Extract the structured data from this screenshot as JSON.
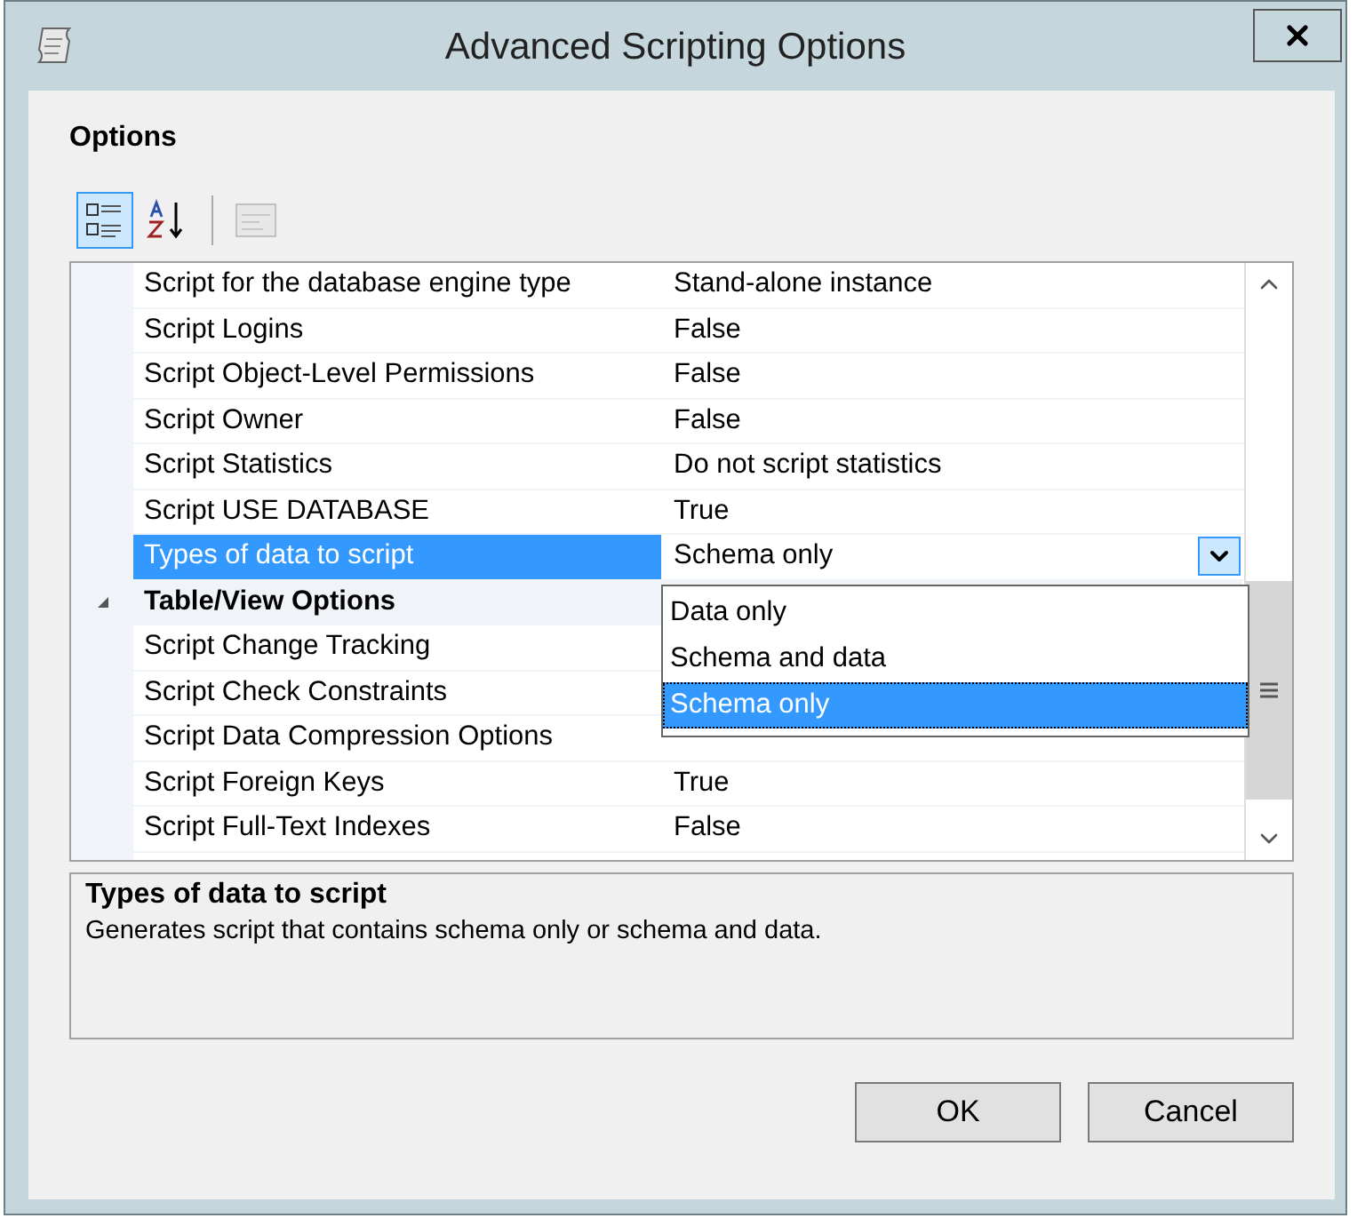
{
  "window": {
    "title": "Advanced Scripting Options"
  },
  "options_label": "Options",
  "toolbar": [
    {
      "kind": "categorized",
      "selected": true,
      "disabled": false
    },
    {
      "kind": "alphabetical",
      "selected": false,
      "disabled": false
    },
    {
      "kind": "property_pages",
      "selected": false,
      "disabled": true
    }
  ],
  "grid": {
    "rows": [
      {
        "kind": "property",
        "name": "Script for the database engine type",
        "value": "Stand-alone instance",
        "selected": false
      },
      {
        "kind": "property",
        "name": "Script Logins",
        "value": "False",
        "selected": false
      },
      {
        "kind": "property",
        "name": "Script Object-Level Permissions",
        "value": "False",
        "selected": false
      },
      {
        "kind": "property",
        "name": "Script Owner",
        "value": "False",
        "selected": false
      },
      {
        "kind": "property",
        "name": "Script Statistics",
        "value": "Do not script statistics",
        "selected": false
      },
      {
        "kind": "property",
        "name": "Script USE DATABASE",
        "value": "True",
        "selected": false
      },
      {
        "kind": "property",
        "name": "Types of data to script",
        "value": "Schema only",
        "selected": true
      },
      {
        "kind": "category",
        "name": "Table/View Options",
        "expanded": true,
        "selected": false
      },
      {
        "kind": "property",
        "name": "Script Change Tracking",
        "selected": false
      },
      {
        "kind": "property",
        "name": "Script Check Constraints",
        "selected": false
      },
      {
        "kind": "property",
        "name": "Script Data Compression Options",
        "selected": false
      },
      {
        "kind": "property",
        "name": "Script Foreign Keys",
        "value": "True",
        "selected": false
      },
      {
        "kind": "property",
        "name": "Script Full-Text Indexes",
        "value": "False",
        "selected": false
      }
    ],
    "dropdown": {
      "items": [
        {
          "label": "Data only",
          "selected": false
        },
        {
          "label": "Schema and data",
          "selected": false
        },
        {
          "label": "Schema only",
          "selected": true
        }
      ]
    }
  },
  "description": {
    "title": "Types of data to script",
    "text": "Generates script that contains schema only or schema and data."
  },
  "buttons": [
    "OK",
    "Cancel"
  ]
}
